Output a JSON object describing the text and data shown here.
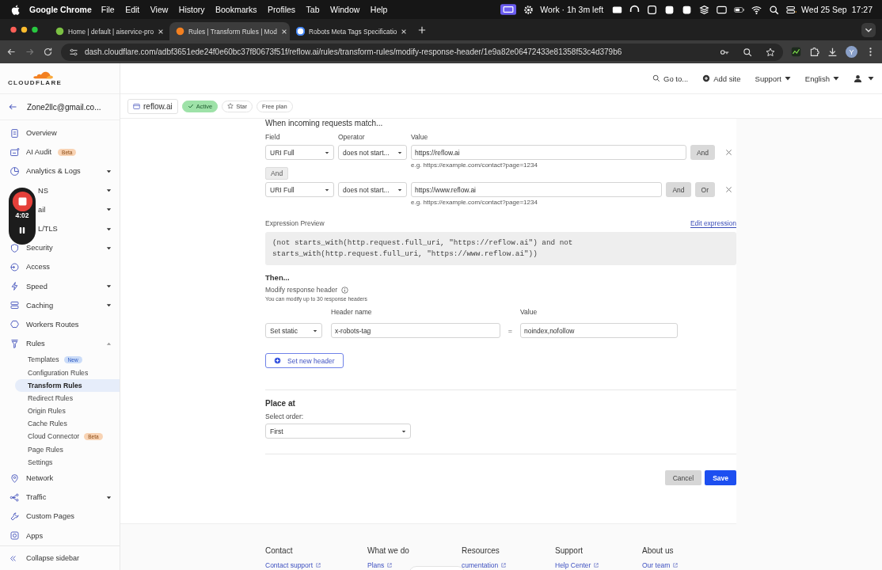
{
  "menubar": {
    "app": "Google Chrome",
    "menus": [
      "File",
      "Edit",
      "View",
      "History",
      "Bookmarks",
      "Profiles",
      "Tab",
      "Window",
      "Help"
    ],
    "focus": "Work · 1h 3m left",
    "date": "Wed 25 Sep",
    "time": "17:27"
  },
  "tabs": [
    {
      "title": "Home | default | aiservice-pro",
      "selected": false
    },
    {
      "title": "Rules | Transform Rules | Mod",
      "selected": true
    },
    {
      "title": "Robots Meta Tags Specificatio",
      "selected": false
    }
  ],
  "address": {
    "url": "dash.cloudflare.com/adbf3651ede24f0e60bc37f80673f51f/reflow.ai/rules/transform-rules/modify-response-header/1e9a82e06472433e81358f53c4d379b6",
    "profile": "Y"
  },
  "cf_header": {
    "logo": "CLOUDFLARE",
    "search": "Go to...",
    "add_site": "Add site",
    "menus": [
      "Support",
      "English"
    ]
  },
  "zone": {
    "name": "reflow.ai",
    "status": "Active",
    "star": "Star",
    "plan": "Free plan"
  },
  "sidebar": {
    "account": "Zone2llc@gmail.co...",
    "items": [
      {
        "label": "Overview"
      },
      {
        "label": "AI Audit",
        "badge": "Beta"
      },
      {
        "label": "Analytics & Logs",
        "expanded": false
      },
      {
        "label": "NS",
        "expanded": false
      },
      {
        "label": "ail",
        "expanded": false
      },
      {
        "label": "L/TLS",
        "expanded": false
      },
      {
        "label": "Security",
        "expanded": false
      },
      {
        "label": "Access"
      },
      {
        "label": "Speed",
        "expanded": false
      },
      {
        "label": "Caching",
        "expanded": false
      },
      {
        "label": "Workers Routes"
      },
      {
        "label": "Rules",
        "expanded": true,
        "children": [
          {
            "label": "Templates",
            "badge": "New",
            "selected": false
          },
          {
            "label": "Configuration Rules",
            "selected": false
          },
          {
            "label": "Transform Rules",
            "selected": true
          },
          {
            "label": "Redirect Rules",
            "selected": false
          },
          {
            "label": "Origin Rules",
            "selected": false
          },
          {
            "label": "Cache Rules",
            "selected": false
          },
          {
            "label": "Cloud Connector",
            "badge": "Beta",
            "selected": false
          },
          {
            "label": "Page Rules",
            "selected": false
          },
          {
            "label": "Settings",
            "selected": false
          }
        ]
      },
      {
        "label": "Network"
      },
      {
        "label": "Traffic",
        "expanded": false
      },
      {
        "label": "Custom Pages"
      },
      {
        "label": "Apps"
      }
    ],
    "collapse": "Collapse sidebar"
  },
  "recorder": {
    "time": "4:02"
  },
  "rule": {
    "heading": "When incoming requests match...",
    "columns": [
      "Field",
      "Operator",
      "Value"
    ],
    "conditions": [
      {
        "field": "URI Full",
        "operator": "does not start...",
        "value": "https://reflow.ai",
        "hint": "e.g. https://example.com/contact?page=1234",
        "buttons": [
          "And"
        ]
      },
      {
        "field": "URI Full",
        "operator": "does not start...",
        "value": "https://www.reflow.ai",
        "hint": "e.g. https://example.com/contact?page=1234",
        "buttons": [
          "And",
          "Or"
        ]
      }
    ],
    "joiner": "And",
    "preview_label": "Expression Preview",
    "edit_link": "Edit expression",
    "expression": "(not starts_with(http.request.full_uri, \"https://reflow.ai\") and not\nstarts_with(http.request.full_uri, \"https://www.reflow.ai\"))",
    "then": "Then...",
    "action": "Modify response header",
    "action_note": "You can modify up to 30 response headers",
    "header_labels": [
      "Header name",
      "Value"
    ],
    "header": {
      "op": "Set static",
      "name": "x-robots-tag",
      "equals": "=",
      "value": "noindex,nofollow"
    },
    "add_header": "Set new header",
    "place_title": "Place at",
    "order_label": "Select order:",
    "order": "First",
    "cancel": "Cancel",
    "save": "Save"
  },
  "footer": [
    {
      "heading": "Contact",
      "link": "Contact support"
    },
    {
      "heading": "What we do",
      "link": "Plans"
    },
    {
      "heading": "Resources",
      "link": "cumentation"
    },
    {
      "heading": "Support",
      "link": "Help Center"
    },
    {
      "heading": "About us",
      "link": "Our team"
    }
  ]
}
